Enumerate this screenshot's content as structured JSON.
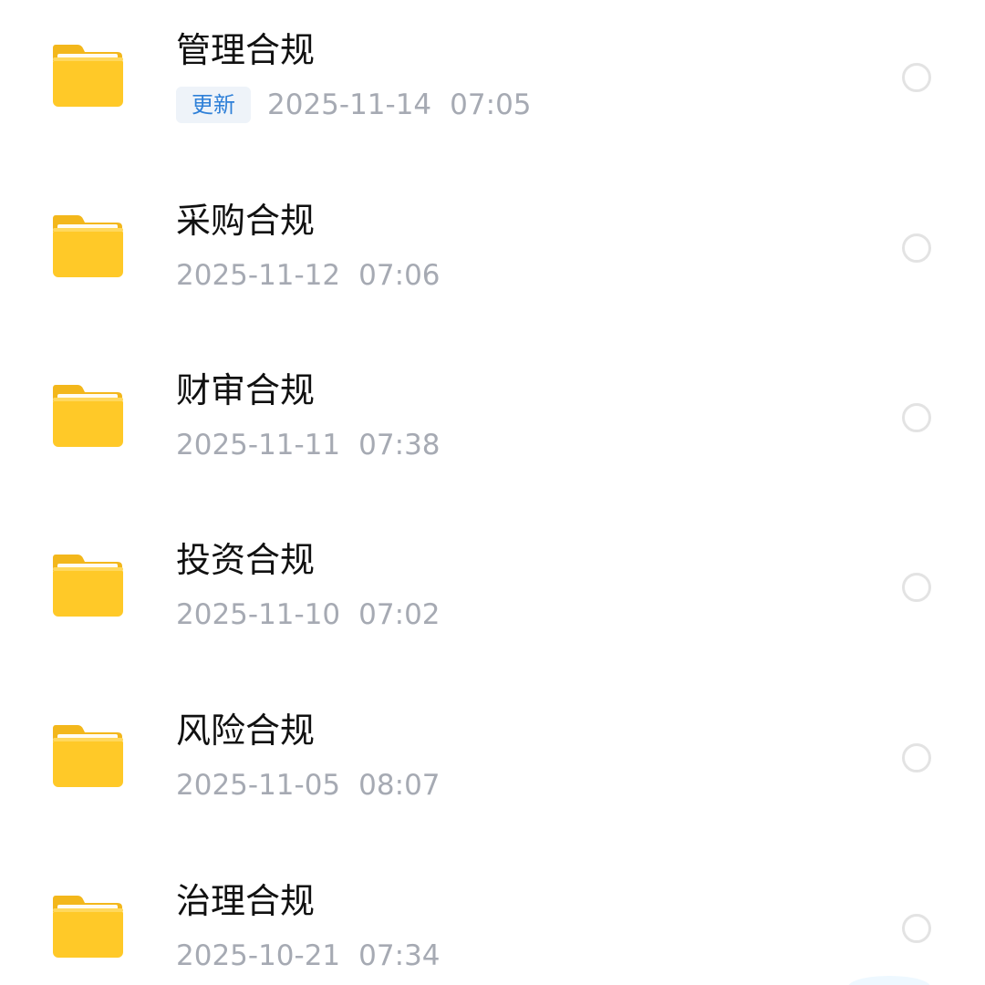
{
  "colors": {
    "folder": "#ffc928",
    "title": "#111111",
    "meta": "#a6aab3",
    "badge_text": "#2f80d8",
    "badge_bg": "#eef3f9",
    "radio_border": "#e3e3e3"
  },
  "items": [
    {
      "icon": "folder-icon",
      "title": "管理合规",
      "badge": "更新",
      "date": "2025-11-14",
      "time": "07:05",
      "selected": false
    },
    {
      "icon": "folder-icon",
      "title": "采购合规",
      "date": "2025-11-12",
      "time": "07:06",
      "selected": false
    },
    {
      "icon": "folder-icon",
      "title": "财审合规",
      "date": "2025-11-11",
      "time": "07:38",
      "selected": false
    },
    {
      "icon": "folder-icon",
      "title": "投资合规",
      "date": "2025-11-10",
      "time": "07:02",
      "selected": false
    },
    {
      "icon": "folder-icon",
      "title": "风险合规",
      "date": "2025-11-05",
      "time": "08:07",
      "selected": false
    },
    {
      "icon": "folder-icon",
      "title": "治理合规",
      "date": "2025-10-21",
      "time": "07:34",
      "selected": false
    }
  ]
}
